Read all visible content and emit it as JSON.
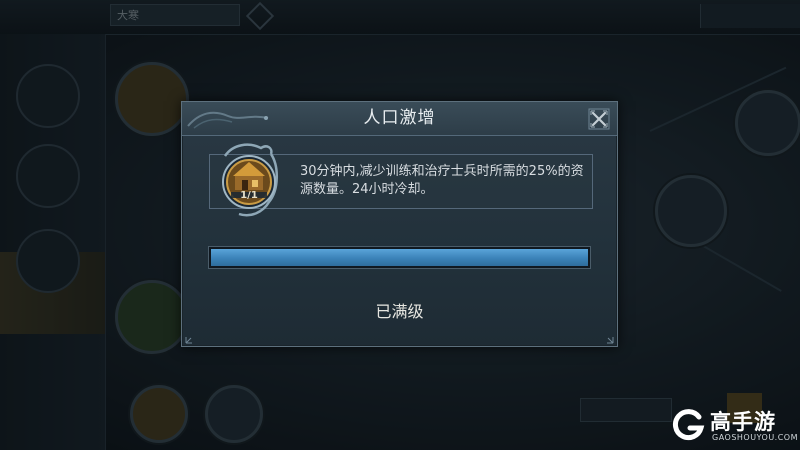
{
  "background": {
    "tab_label": "大寒",
    "accent_color": "#3b82b8"
  },
  "modal": {
    "title": "人口激增",
    "close_icon": "close-x-icon",
    "skill": {
      "icon": "city-building-icon",
      "level_text": "1/1",
      "description": "30分钟内,减少训练和治疗士兵时所需的25%的资源数量。24小时冷却。"
    },
    "progress": {
      "fraction": 1.0
    },
    "status_text": "已满级"
  },
  "watermark": {
    "title": "高手游",
    "subtitle": "GAOSHOUYOU.COM"
  }
}
